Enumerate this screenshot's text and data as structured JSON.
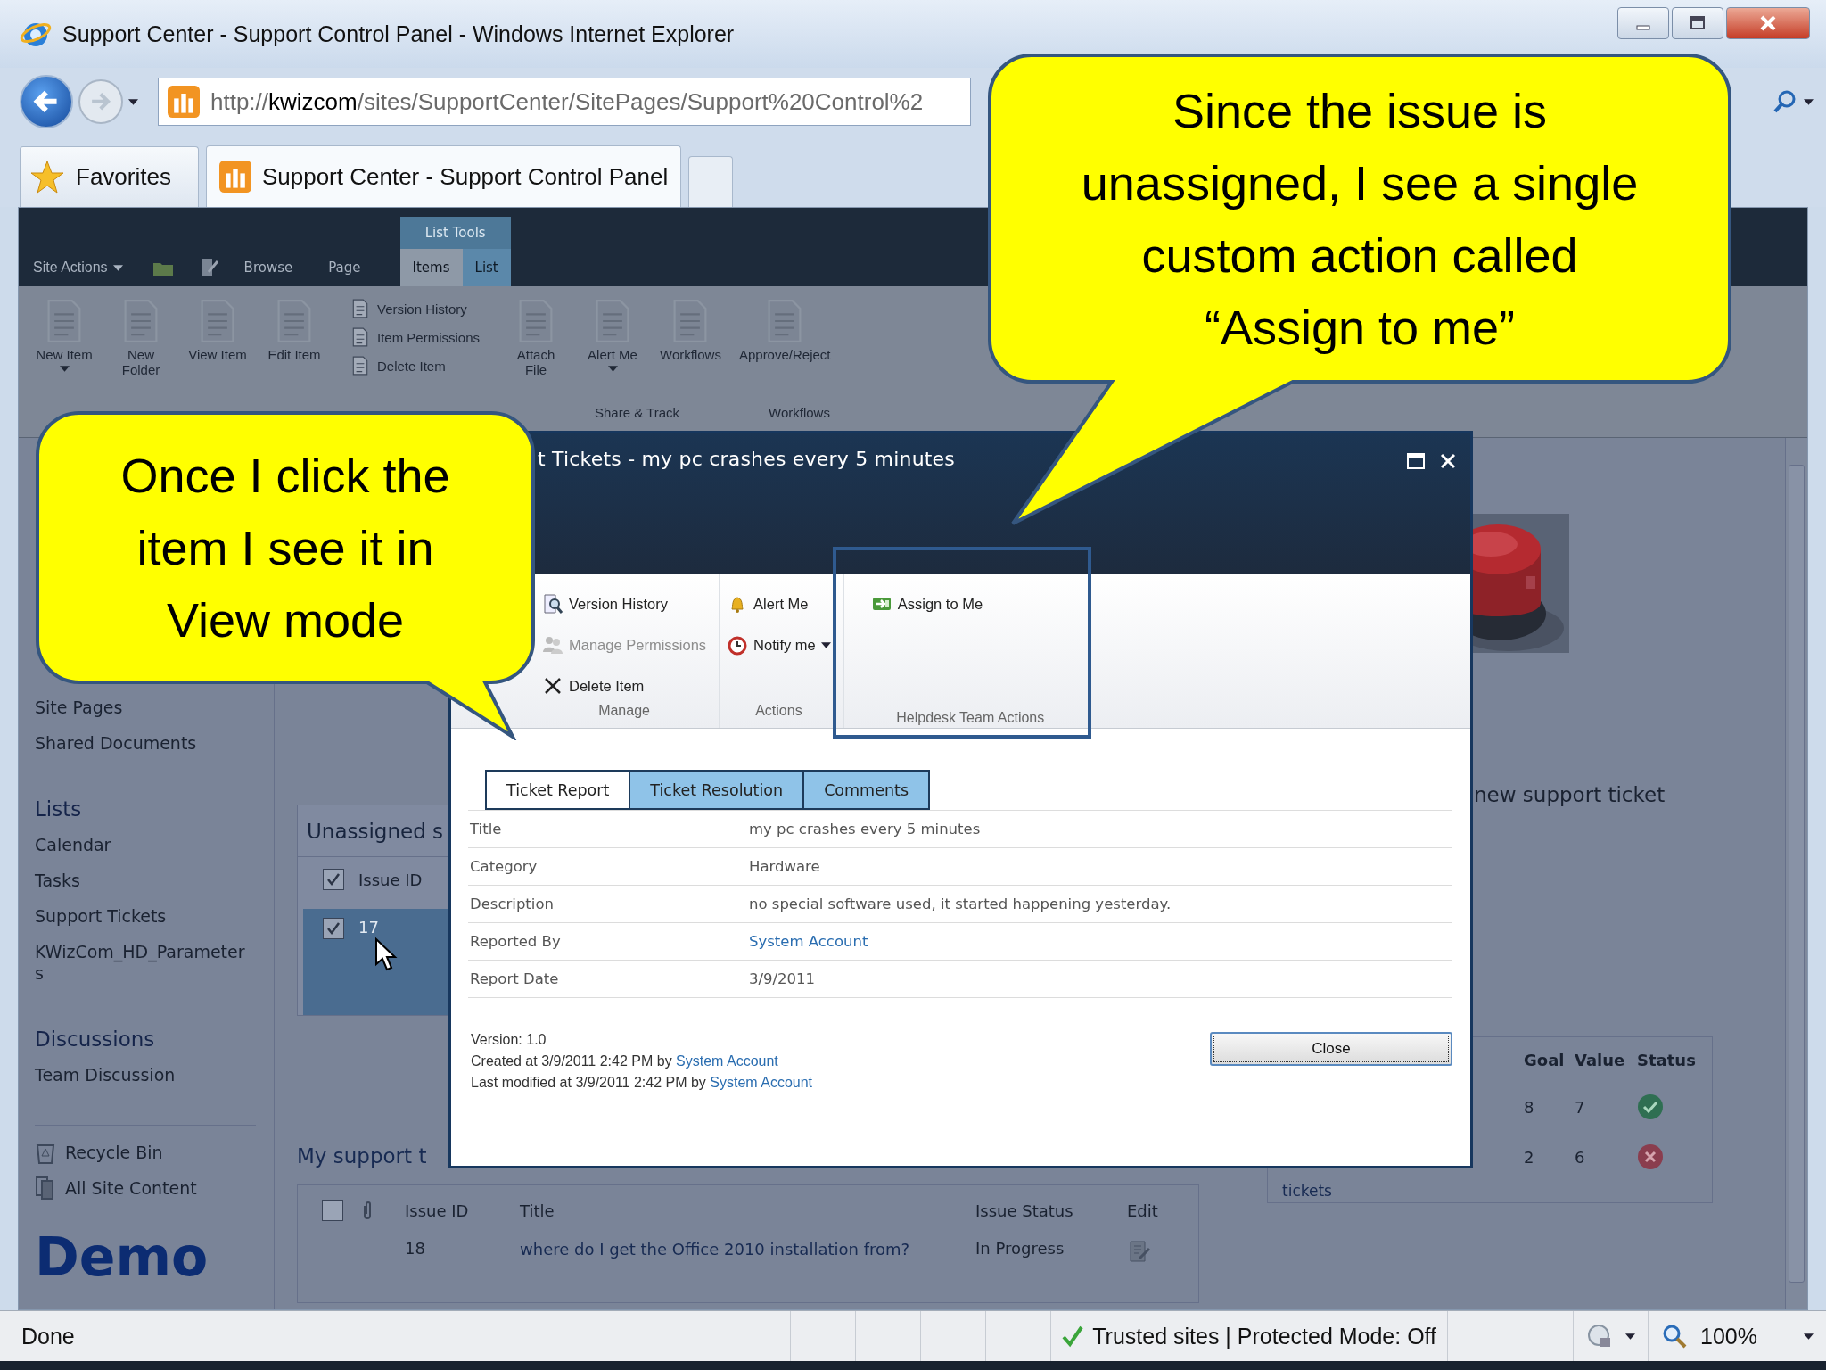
{
  "window": {
    "title": "Support Center - Support Control Panel - Windows Internet Explorer"
  },
  "window_controls": [
    {
      "kind": "minimize"
    },
    {
      "kind": "maximize"
    },
    {
      "kind": "close"
    }
  ],
  "address_bar": {
    "url": "http://**kwizcom**/sites/SupportCenter/SitePages/Support%20Control%2"
  },
  "favorites": {
    "label": "Favorites"
  },
  "tabs": [
    {
      "label": "Support Center - Support Control Panel",
      "selected": true
    }
  ],
  "ribbon": {
    "site_actions": "Site Actions",
    "context_group": "List Tools",
    "tabs": [
      {
        "label": "Browse",
        "selected": false,
        "contextual": false
      },
      {
        "label": "Page",
        "selected": false,
        "contextual": false
      },
      {
        "label": "Items",
        "selected": true,
        "contextual": true
      },
      {
        "label": "List",
        "selected": false,
        "contextual": true
      }
    ],
    "buttons": [
      {
        "kind": "large",
        "label": "New Item",
        "dropdown": true
      },
      {
        "kind": "large",
        "label": "New Folder",
        "dropdown": false
      },
      {
        "kind": "large",
        "label": "View Item",
        "dropdown": false
      },
      {
        "kind": "large",
        "label": "Edit Item",
        "dropdown": false
      },
      {
        "kind": "stack",
        "items": [
          {
            "label": "Version History"
          },
          {
            "label": "Item Permissions"
          },
          {
            "label": "Delete Item"
          }
        ]
      },
      {
        "kind": "large",
        "label": "Attach File",
        "dropdown": false
      },
      {
        "kind": "large",
        "label": "Alert Me",
        "dropdown": true
      },
      {
        "kind": "wide",
        "label": "Workflows",
        "dropdown": false
      },
      {
        "kind": "wide",
        "label": "Approve/Reject",
        "dropdown": false
      }
    ],
    "group_labels": [
      "Share & Track",
      "Workflows"
    ]
  },
  "quick_launch": {
    "items": [
      {
        "kind": "link",
        "label": "Site Pages"
      },
      {
        "kind": "link",
        "label": "Shared Documents"
      },
      {
        "kind": "heading",
        "label": "Lists"
      },
      {
        "kind": "link",
        "label": "Calendar"
      },
      {
        "kind": "link",
        "label": "Tasks"
      },
      {
        "kind": "link",
        "label": "Support Tickets"
      },
      {
        "kind": "link",
        "label": "KWizCom_HD_Parameters"
      },
      {
        "kind": "heading",
        "label": "Discussions"
      },
      {
        "kind": "link",
        "label": "Team Discussion"
      }
    ],
    "footer_links": [
      {
        "label": "Recycle Bin"
      },
      {
        "label": "All Site Content"
      }
    ]
  },
  "demo_label": "Demo",
  "unassigned_webpart": {
    "title": "Unassigned s",
    "column": "Issue ID",
    "header_checked": true,
    "rows": [
      {
        "issue_id": "17",
        "checked": true,
        "selected": true
      }
    ]
  },
  "my_tickets": {
    "title": "My support t",
    "header_checked": false,
    "columns": [
      "Issue ID",
      "Title",
      "Issue Status",
      "Edit"
    ],
    "rows": [
      {
        "issue_id": "18",
        "title": "where do I get the Office 2010 installation from?",
        "status": "In Progress"
      }
    ]
  },
  "new_ticket_link": "new support ticket",
  "kpi": {
    "columns": [
      "Goal",
      "Value",
      "Status"
    ],
    "rows": [
      {
        "goal": "8",
        "value": "7",
        "kind": "ok"
      },
      {
        "goal": "2",
        "value": "6",
        "kind": "bad"
      }
    ],
    "footer": "tickets"
  },
  "dialog": {
    "title": "t Tickets - my pc crashes every 5 minutes",
    "ribbon_groups": [
      {
        "label": "Manage",
        "highlighted": false,
        "items": [
          {
            "label": "Version History",
            "disabled": false,
            "dropdown": false
          },
          {
            "label": "Manage Permissions",
            "disabled": true,
            "dropdown": false
          },
          {
            "label": "Delete Item",
            "disabled": false,
            "dropdown": false
          }
        ]
      },
      {
        "label": "Actions",
        "highlighted": false,
        "items": [
          {
            "label": "Alert Me",
            "disabled": false,
            "dropdown": false
          },
          {
            "label": "Notify me",
            "disabled": false,
            "dropdown": true
          }
        ]
      },
      {
        "label": "Helpdesk Team Actions",
        "highlighted": true,
        "items": [
          {
            "label": "Assign to Me",
            "disabled": false,
            "dropdown": false
          }
        ]
      }
    ],
    "tabs": [
      {
        "label": "Ticket Report",
        "selected": true
      },
      {
        "label": "Ticket Resolution",
        "selected": false
      },
      {
        "label": "Comments",
        "selected": false
      }
    ],
    "fields": [
      {
        "label": "Title",
        "value": "my pc crashes every 5 minutes",
        "link": false
      },
      {
        "label": "Category",
        "value": "Hardware",
        "link": false
      },
      {
        "label": "Description",
        "value": "no special software used, it started happening yesterday.",
        "link": false
      },
      {
        "label": "Reported By",
        "value": "System Account",
        "link": true
      },
      {
        "label": "Report Date",
        "value": "3/9/2011",
        "link": false
      }
    ],
    "version": "Version: 1.0",
    "created": {
      "text": "Created at 3/9/2011 2:42 PM by",
      "author": "System Account"
    },
    "modified": {
      "text": "Last modified at 3/9/2011 2:42 PM by",
      "author": "System Account"
    },
    "close_button": "Close"
  },
  "callouts": [
    {
      "text": "Once I click the item I see it in View mode"
    },
    {
      "text": "Since the issue is unassigned, I see a single custom action called “Assign to me”"
    }
  ],
  "status_bar": {
    "text": "Done",
    "zone": "Trusted sites | Protected Mode: Off",
    "zoom": "100%"
  }
}
